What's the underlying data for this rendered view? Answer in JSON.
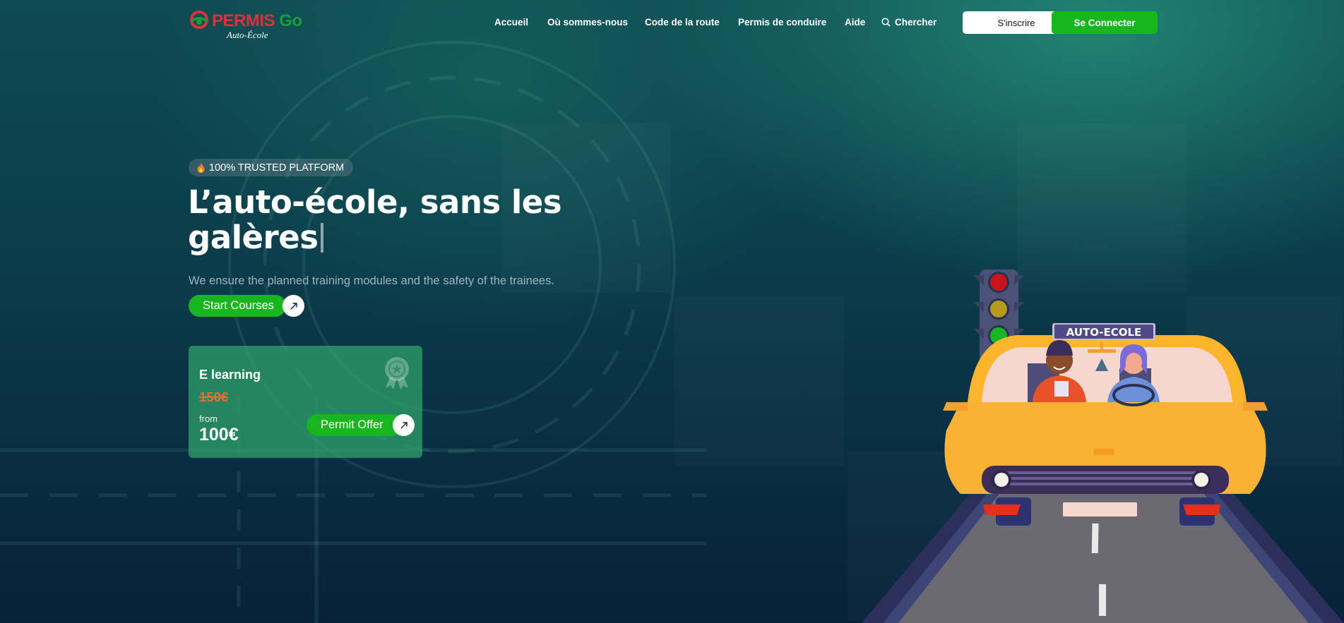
{
  "brand": {
    "name_part1": "PERMIS",
    "name_part2": "Go",
    "tagline": "Auto-École"
  },
  "nav": {
    "items": [
      {
        "label": "Accueil"
      },
      {
        "label": "Où sommes-nous"
      },
      {
        "label": "Code de la route"
      },
      {
        "label": "Permis de conduire"
      },
      {
        "label": "Aide"
      }
    ],
    "search_label": "Chercher",
    "signup_label": "S'inscrire",
    "login_label": "Se Connecter"
  },
  "hero": {
    "badge_icon": "flame-icon",
    "badge_text": "100% TRUSTED PLATFORM",
    "title_line1": "L’auto-école, sans les",
    "title_line2": "galères",
    "subtitle": "We ensure the planned training modules and the safety of the trainees.",
    "cta_label": "Start Courses"
  },
  "offer_card": {
    "title": "E learning",
    "old_price": "150€",
    "from_label": "from",
    "price": "100€",
    "button_label": "Permit Offer",
    "icon": "award-ribbon-icon"
  },
  "illustration": {
    "car_sign": "AUTO-ECOLE",
    "traffic_light_colors": [
      "#c8141b",
      "#d4a818",
      "#19b624"
    ]
  },
  "colors": {
    "accent_green": "#18b51f",
    "brand_red": "#e0303a",
    "price_strike": "#f36b2e",
    "card_bg": "#30a56e"
  }
}
